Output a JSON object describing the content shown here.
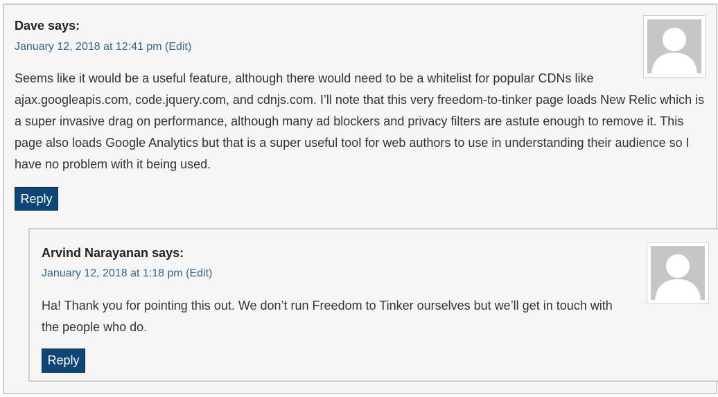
{
  "comments": [
    {
      "author": "Dave",
      "says": "says:",
      "date": "January 12, 2018 at 12:41 pm",
      "edit": "(Edit)",
      "text": "Seems like it would be a useful feature, although there would need to be a whitelist for popular CDNs like ajax.googleapis.com, code.jquery.com, and cdnjs.com. I’ll note that this very freedom-to-tinker page loads New Relic which is a super invasive drag on performance, although many ad blockers and privacy filters are astute enough to remove it. This page also loads Google Analytics but that is a super useful tool for web authors to use in understanding their audience so I have no problem with it being used.",
      "reply": "Reply",
      "avatar_icon": "default-person-avatar-icon"
    },
    {
      "author": "Arvind Narayanan",
      "says": "says:",
      "date": "January 12, 2018 at 1:18 pm",
      "edit": "(Edit)",
      "text": "Ha! Thank you for pointing this out. We don’t run Freedom to Tinker ourselves but we’ll get in touch with the people who do.",
      "reply": "Reply",
      "avatar_icon": "default-person-avatar-icon"
    }
  ],
  "colors": {
    "background": "#f5f5f5",
    "border": "#cfcfcf",
    "link": "#2f6690",
    "reply_button": "#0d4677"
  }
}
